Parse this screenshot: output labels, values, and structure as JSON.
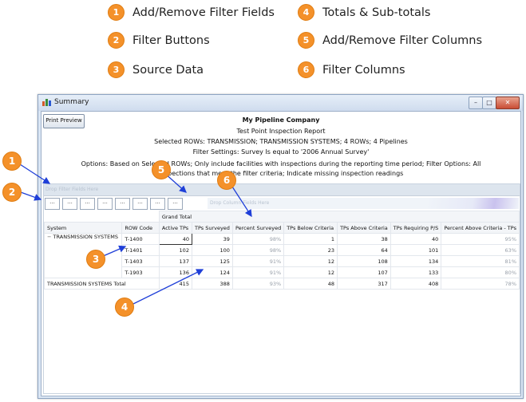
{
  "legend": [
    {
      "num": "1",
      "label": "Add/Remove Filter Fields"
    },
    {
      "num": "2",
      "label": "Filter Buttons"
    },
    {
      "num": "3",
      "label": "Source Data"
    },
    {
      "num": "4",
      "label": "Totals & Sub-totals"
    },
    {
      "num": "5",
      "label": "Add/Remove Filter Columns"
    },
    {
      "num": "6",
      "label": "Filter Columns"
    }
  ],
  "window": {
    "title": "Summary"
  },
  "toolbar": {
    "print_preview": "Print Preview"
  },
  "report": {
    "company": "My Pipeline Company",
    "title": "Test Point Inspection Report",
    "selected_rows": "Selected ROWs: TRANSMISSION; TRANSMISSION SYSTEMS; 4 ROWs; 4 Pipelines",
    "filter_settings": "Filter Settings: Survey Is equal to '2006 Annual Survey'",
    "options_line1": "Options: Based on Selected ROWs; Only include facilities with inspections during the reporting time period; Filter Options: All",
    "options_line2": "inspections that meet the filter criteria; Indicate missing inspection readings"
  },
  "pivot": {
    "filter_drop_text": "Drop Filter Fields Here",
    "column_drop_text": "Drop Column Fields Here",
    "filter_buttons": [
      "...",
      "...",
      "...",
      "...",
      "...",
      "...",
      "...",
      "..."
    ],
    "grand_total_label": "Grand Total",
    "row_headers": [
      "System",
      "ROW Code"
    ],
    "columns": [
      "Active TPs",
      "TPs Surveyed",
      "Percent Surveyed",
      "TPs Below Criteria",
      "TPs Above Criteria",
      "TPs Requiring P/S",
      "Percent Above Criteria - TPs"
    ],
    "group": "TRANSMISSION SYSTEMS",
    "rows": [
      {
        "code": "T-1400",
        "values": [
          "40",
          "39",
          "98%",
          "1",
          "38",
          "40",
          "95%"
        ]
      },
      {
        "code": "T-1401",
        "values": [
          "102",
          "100",
          "98%",
          "23",
          "64",
          "101",
          "63%"
        ]
      },
      {
        "code": "T-1403",
        "values": [
          "137",
          "125",
          "91%",
          "12",
          "108",
          "134",
          "81%"
        ]
      },
      {
        "code": "T-1903",
        "values": [
          "136",
          "124",
          "91%",
          "12",
          "107",
          "133",
          "80%"
        ]
      }
    ],
    "total": {
      "label": "TRANSMISSION SYSTEMS Total",
      "values": [
        "415",
        "388",
        "93%",
        "48",
        "317",
        "408",
        "78%"
      ]
    }
  },
  "callouts": [
    "1",
    "2",
    "3",
    "4",
    "5",
    "6"
  ]
}
